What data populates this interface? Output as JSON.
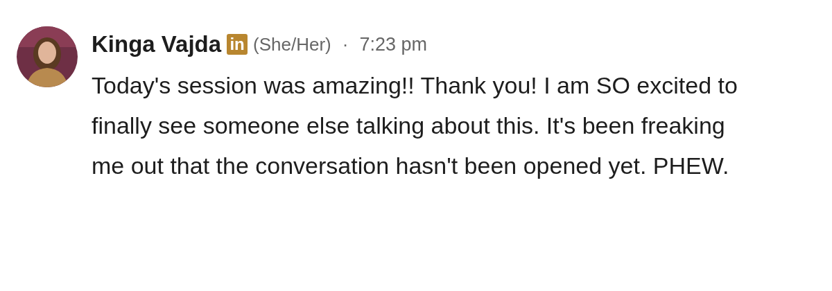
{
  "message": {
    "author": "Kinga Vajda",
    "badge": "in",
    "pronouns": "(She/Her)",
    "separator": "·",
    "time": "7:23 pm",
    "text": "Today's session was amazing!! Thank you! I am SO excited to finally see someone else talking about this. It's been freaking me out that the conversation hasn't been opened yet. PHEW."
  }
}
